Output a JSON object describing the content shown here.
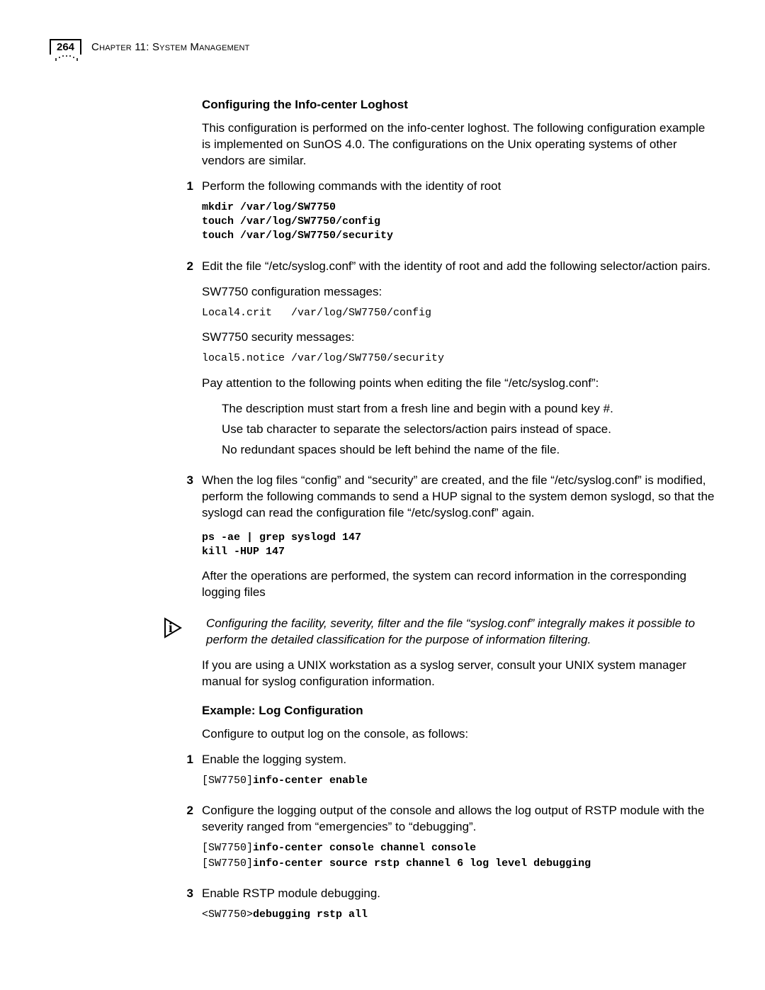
{
  "header": {
    "page_number": "264",
    "chapter_label": "Chapter 11: System Management"
  },
  "section1": {
    "heading": "Configuring the Info-center Loghost",
    "intro": "This configuration is performed on the info-center loghost. The following configuration example is implemented on SunOS 4.0. The configurations on the Unix operating systems of other vendors are similar.",
    "step1": {
      "num": "1",
      "text": "Perform the following commands with the identity of root",
      "code": "mkdir /var/log/SW7750\ntouch /var/log/SW7750/config\ntouch /var/log/SW7750/security"
    },
    "step2": {
      "num": "2",
      "text": "Edit the file “/etc/syslog.conf” with the identity of root and add the following selector/action pairs.",
      "line_a": "SW7750 configuration messages:",
      "code_a": "Local4.crit   /var/log/SW7750/config",
      "line_b": "SW7750 security messages:",
      "code_b": "local5.notice /var/log/SW7750/security",
      "attention_intro": "Pay attention to the following points when editing the file “/etc/syslog.conf”:",
      "bullet1": "The description must start from a fresh line and begin with a pound key #.",
      "bullet2": "Use tab character to separate the selectors/action pairs instead of space.",
      "bullet3": "No redundant spaces should be left behind the name of the file."
    },
    "step3": {
      "num": "3",
      "text": "When the log files “config” and “security” are created, and the file “/etc/syslog.conf” is modified, perform the following commands to send a HUP signal to the system demon syslogd, so that the syslogd can read the configuration file “/etc/syslog.conf” again.",
      "code": "ps -ae | grep syslogd 147\nkill -HUP 147",
      "after": "After the operations are performed, the system can record information in the corresponding logging files"
    },
    "note": "Configuring the facility, severity, filter and the file “syslog.conf” integrally makes it possible to perform the detailed classification for the purpose of information filtering.",
    "unix_para": "If you are using a UNIX workstation as a syslog server, consult your UNIX system manager manual for syslog configuration information."
  },
  "section2": {
    "heading": "Example: Log Configuration",
    "intro": "Configure to output log on the console, as follows:",
    "step1": {
      "num": "1",
      "text": "Enable the logging system.",
      "code_prefix": "[SW7750]",
      "code_bold": "info-center enable"
    },
    "step2": {
      "num": "2",
      "text": "Configure the logging output of the console and allows the log output of RSTP module with the severity ranged from “emergencies” to “debugging”.",
      "code_prefix1": "[SW7750]",
      "code_bold1": "info-center console channel console",
      "code_prefix2": "[SW7750]",
      "code_bold2": "info-center source rstp channel 6 log level debugging"
    },
    "step3": {
      "num": "3",
      "text": "Enable RSTP module debugging.",
      "code_prefix": "<SW7750>",
      "code_bold": "debugging rstp all"
    }
  }
}
